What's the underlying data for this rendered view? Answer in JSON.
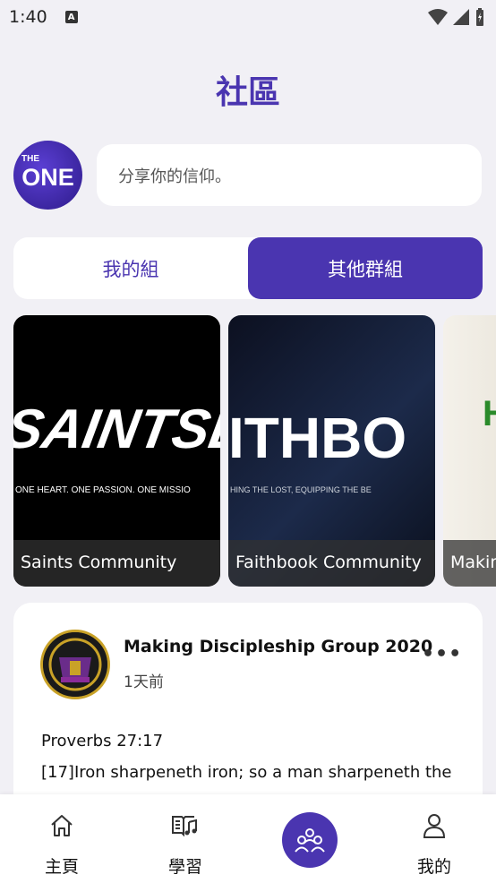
{
  "status_bar": {
    "time": "1:40",
    "notif_icon": "A"
  },
  "header": {
    "title": "社區"
  },
  "composer": {
    "placeholder": "分享你的信仰。",
    "logo_small": "THE",
    "logo_big": "ONE"
  },
  "tabs": [
    {
      "label": "我的組",
      "active": false
    },
    {
      "label": "其他群組",
      "active": true
    }
  ],
  "communities": [
    {
      "name": "Saints Community",
      "banner_text": "SAINTSE",
      "tagline": "ONE HEART. ONE PASSION. ONE MISSIO"
    },
    {
      "name": "Faithbook Community",
      "banner_text": "ITHBO",
      "tagline": "HING THE LOST, EQUIPPING THE BE"
    },
    {
      "name": "Making",
      "banner_text": "H"
    }
  ],
  "post": {
    "group_name": "Making Discipleship Group 2020",
    "time": "1天前",
    "more": "•••",
    "reference": "Proverbs 27:17",
    "body": "[17]Iron sharpeneth iron; so a man sharpeneth the"
  },
  "nav": {
    "home": "主頁",
    "learn": "學習",
    "profile": "我的"
  },
  "colors": {
    "accent": "#4a35b0",
    "background": "#f1f0f5"
  }
}
